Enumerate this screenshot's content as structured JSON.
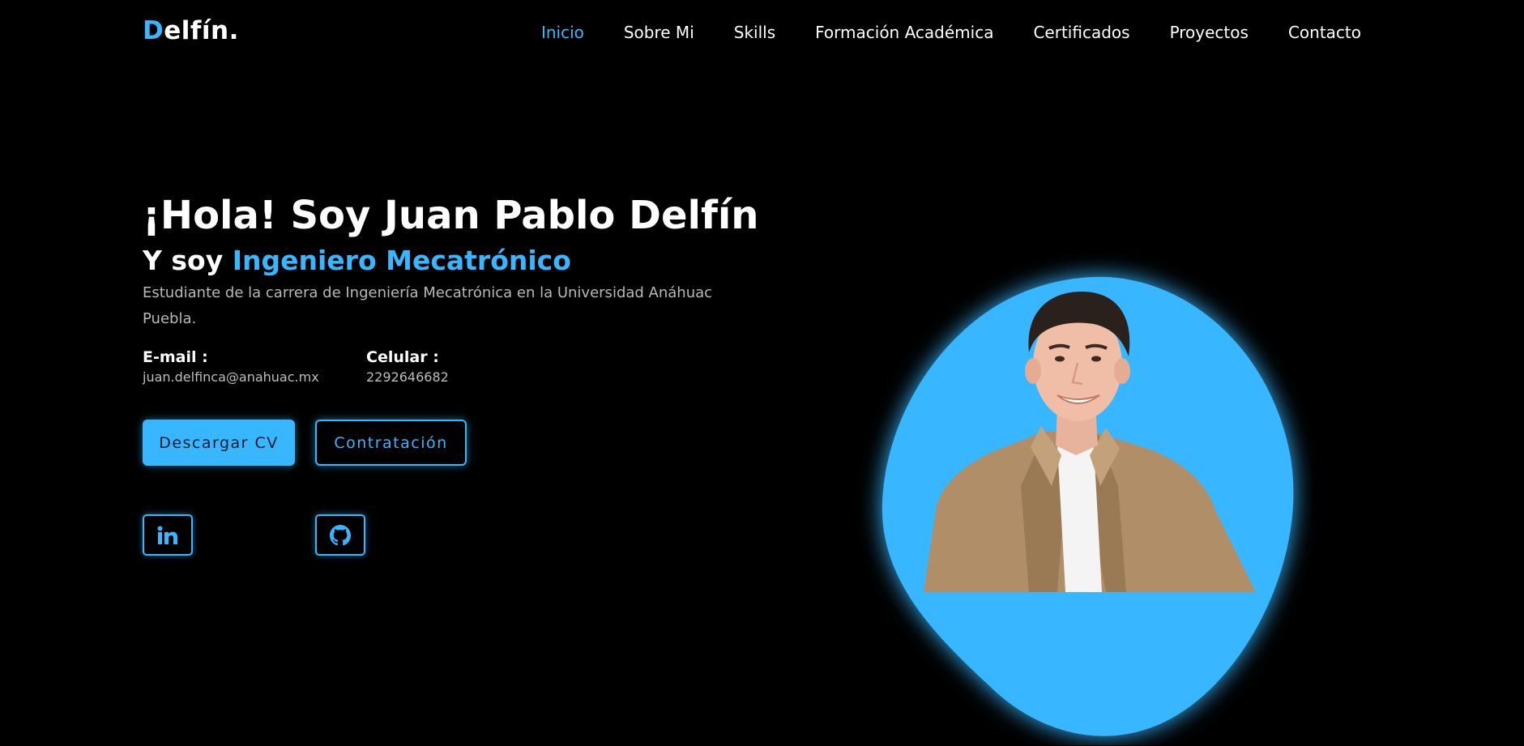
{
  "header": {
    "logo_first": "D",
    "logo_rest": "elfín."
  },
  "nav": {
    "items": [
      {
        "label": "Inicio",
        "active": true
      },
      {
        "label": "Sobre Mi"
      },
      {
        "label": "Skills"
      },
      {
        "label": "Formación Académica"
      },
      {
        "label": "Certificados"
      },
      {
        "label": "Proyectos"
      },
      {
        "label": "Contacto"
      }
    ]
  },
  "hero": {
    "title": "¡Hola! Soy Juan Pablo Delfín",
    "subtitle_prefix": "Y soy ",
    "subtitle_role": "Ingeniero Mecatrónico",
    "description": "Estudiante de la carrera de Ingeniería Mecatrónica en la Universidad Anáhuac Puebla.",
    "email_label": "E-mail :",
    "email_value": "juan.delfinca@anahuac.mx",
    "phone_label": "Celular :",
    "phone_value": "2292646682"
  },
  "buttons": {
    "cv": "Descargar CV",
    "hire": "Contratación"
  },
  "social": {
    "linkedin_icon": "linkedin-icon",
    "github_icon": "github-icon"
  },
  "portrait": {
    "blob_icon": "profile-photo",
    "accent": "#38b6ff"
  },
  "colors": {
    "accent": "#38b6ff",
    "background": "#000000",
    "text": "#ffffff",
    "muted": "#b8b8b8"
  }
}
